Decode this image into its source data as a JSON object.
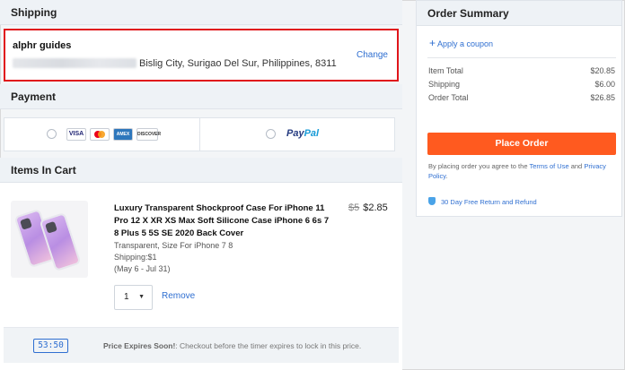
{
  "shipping": {
    "heading": "Shipping",
    "name": "alphr guides",
    "address": "Bislig City, Surigao Del Sur, Philippines, 8311",
    "change_label": "Change"
  },
  "payment": {
    "heading": "Payment",
    "card_logos": [
      "VISA",
      "MC",
      "AMEX",
      "DISCOVER"
    ],
    "paypal_part1": "Pay",
    "paypal_part2": "Pal"
  },
  "cart": {
    "heading": "Items In Cart",
    "item": {
      "title": "Luxury Transparent Shockproof Case For iPhone 11 Pro 12 X XR XS Max Soft Silicone Case iPhone 6 6s 7 8 Plus 5 5S SE 2020 Back Cover",
      "old_price": "$5",
      "price": "$2.85",
      "variant": "Transparent, Size For iPhone 7 8",
      "shipping": "Shipping:$1",
      "delivery": "(May 6 - Jul 31)",
      "quantity": "1",
      "remove_label": "Remove"
    },
    "timer": "53:50",
    "expire_bold": "Price Expires Soon!",
    "expire_text": ": Checkout before the timer expires to lock in this price."
  },
  "summary": {
    "heading": "Order Summary",
    "coupon_label": "Apply a coupon",
    "lines": [
      {
        "label": "Item Total",
        "value": "$20.85"
      },
      {
        "label": "Shipping",
        "value": "$6.00"
      },
      {
        "label": "Order Total",
        "value": "$26.85"
      }
    ],
    "place_order": "Place Order",
    "agree_prefix": "By placing order you agree to the ",
    "terms": "Terms of Use",
    "agree_and": " and ",
    "privacy": "Privacy Policy",
    "agree_suffix": ".",
    "free_return": "30 Day Free Return and Refund"
  },
  "colors": {
    "accent": "#ff5a1f",
    "link": "#2f6fd1",
    "highlight": "#e0161b"
  }
}
